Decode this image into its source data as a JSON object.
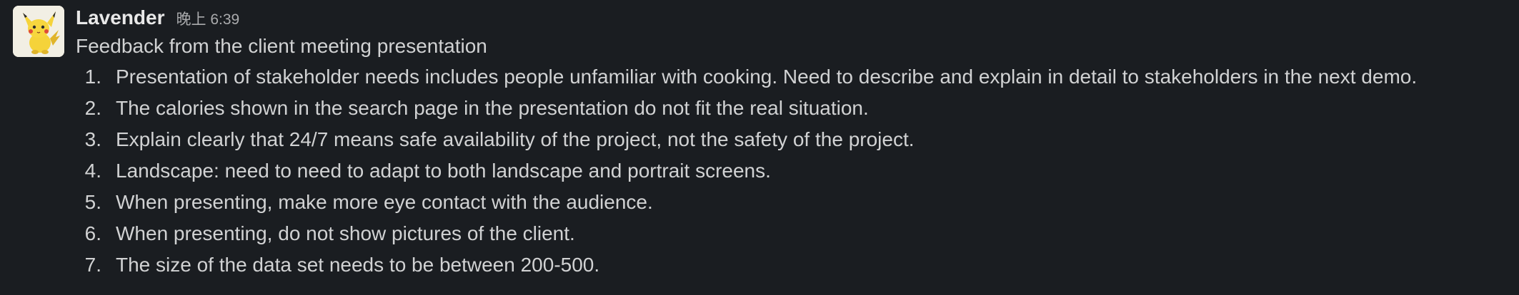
{
  "message": {
    "sender": "Lavender",
    "timestamp": "晚上 6:39",
    "avatar_icon": "pikachu-avatar",
    "intro": "Feedback from the client meeting presentation",
    "items": [
      {
        "number": "1.",
        "text": "Presentation of stakeholder needs includes people unfamiliar with cooking. Need to describe and explain in detail to stakeholders in the next demo."
      },
      {
        "number": "2.",
        "text": "The calories shown in the search page in the presentation do not fit the real situation."
      },
      {
        "number": "3.",
        "text": "Explain clearly that 24/7 means safe availability of the project, not the safety of the project."
      },
      {
        "number": "4.",
        "text": "Landscape: need to need to adapt to both landscape and portrait screens."
      },
      {
        "number": "5.",
        "text": "When presenting, make more eye contact with the audience."
      },
      {
        "number": "6.",
        "text": "When presenting, do not show pictures of the client."
      },
      {
        "number": "7.",
        "text": "The size of the data set needs to be between 200-500."
      }
    ]
  },
  "colors": {
    "background": "#1a1d21",
    "text": "#d1d2d3",
    "sender": "#e8e8e8",
    "timestamp": "#aaabad"
  }
}
